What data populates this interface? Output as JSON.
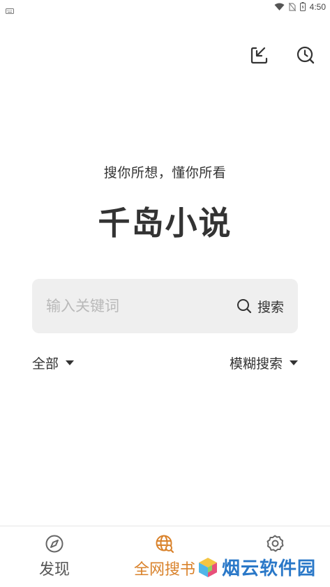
{
  "status_bar": {
    "time": "4:50"
  },
  "header": {
    "slogan": "搜你所想，懂你所看",
    "title": "千岛小说"
  },
  "search": {
    "placeholder": "输入关键词",
    "button_label": "搜索"
  },
  "filters": {
    "scope": "全部",
    "mode": "模糊搜索"
  },
  "bottom_nav": {
    "items": [
      {
        "label": "发现",
        "icon": "compass-icon"
      },
      {
        "label": "全网搜书",
        "icon": "globe-search-icon"
      },
      {
        "label": "",
        "icon": "gear-icon"
      }
    ]
  },
  "watermark": {
    "text": "烟云软件园"
  },
  "colors": {
    "accent": "#d9822b",
    "search_bg": "#efefef"
  }
}
